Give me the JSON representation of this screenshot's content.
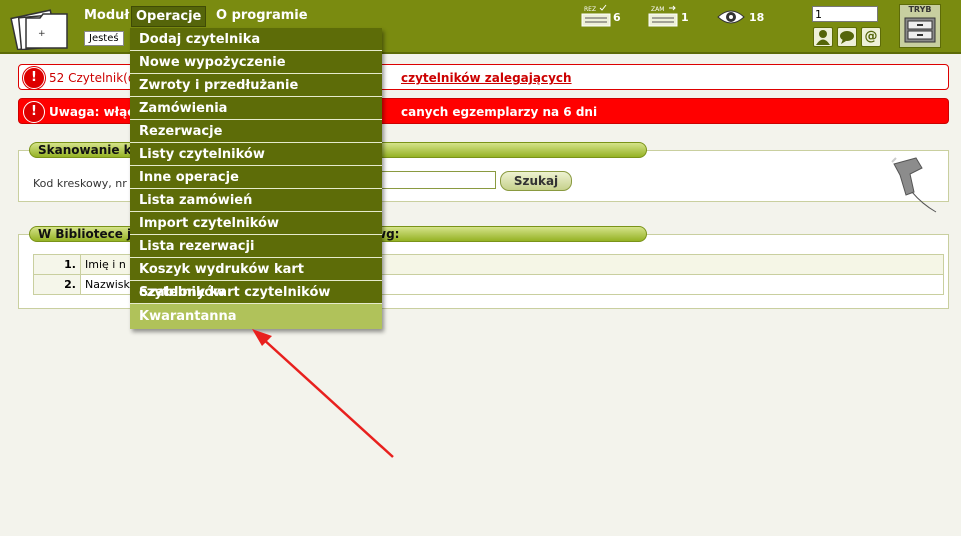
{
  "topbar": {
    "menu": [
      "Moduł",
      "Operacje",
      "O programie"
    ],
    "active_menu": "Operacje",
    "breadcrumb": "Jesteś",
    "stats": [
      {
        "icon": "reservations-icon",
        "label": "REZ",
        "value": "6"
      },
      {
        "icon": "orders-icon",
        "label": "ZAM",
        "value": "1"
      },
      {
        "icon": "eye-icon",
        "value": "18"
      }
    ],
    "quick_input_value": "1",
    "mode_label": "TRYB"
  },
  "alerts": {
    "first_text": "52 Czytelnik(ó",
    "first_link": "czytelników zalegających",
    "second_text": "Uwaga: włącz",
    "second_tail": "canych egzemplarzy na 6 dni"
  },
  "scan_panel": {
    "title": "Skanowanie k",
    "label": "Kod kreskowy, nr",
    "button": "Szukaj"
  },
  "library_panel": {
    "title_left": "W Bibliotece je",
    "title_right": "wg:",
    "rows": [
      {
        "num": "1.",
        "text": "Imię i n"
      },
      {
        "num": "2.",
        "text": "Nazwisk"
      }
    ]
  },
  "dropdown": {
    "items": [
      "Dodaj czytelnika",
      "Nowe wypożyczenie",
      "Zwroty i przedłużanie",
      "Zamówienia",
      "Rezerwacje",
      "Listy czytelników",
      "Inne operacje",
      "Lista zamówień",
      "Import czytelników",
      "Lista rezerwacji",
      "Koszyk wydruków kart czytelników",
      "Szablony kart czytelników",
      "Kwarantanna"
    ],
    "highlighted": "Kwarantanna"
  },
  "colors": {
    "bar": "#7a8b10",
    "menu_bg": "#5d6c08",
    "highlight": "#b0c25a",
    "alert_red": "#ff0000",
    "arrow": "#e8201e"
  }
}
